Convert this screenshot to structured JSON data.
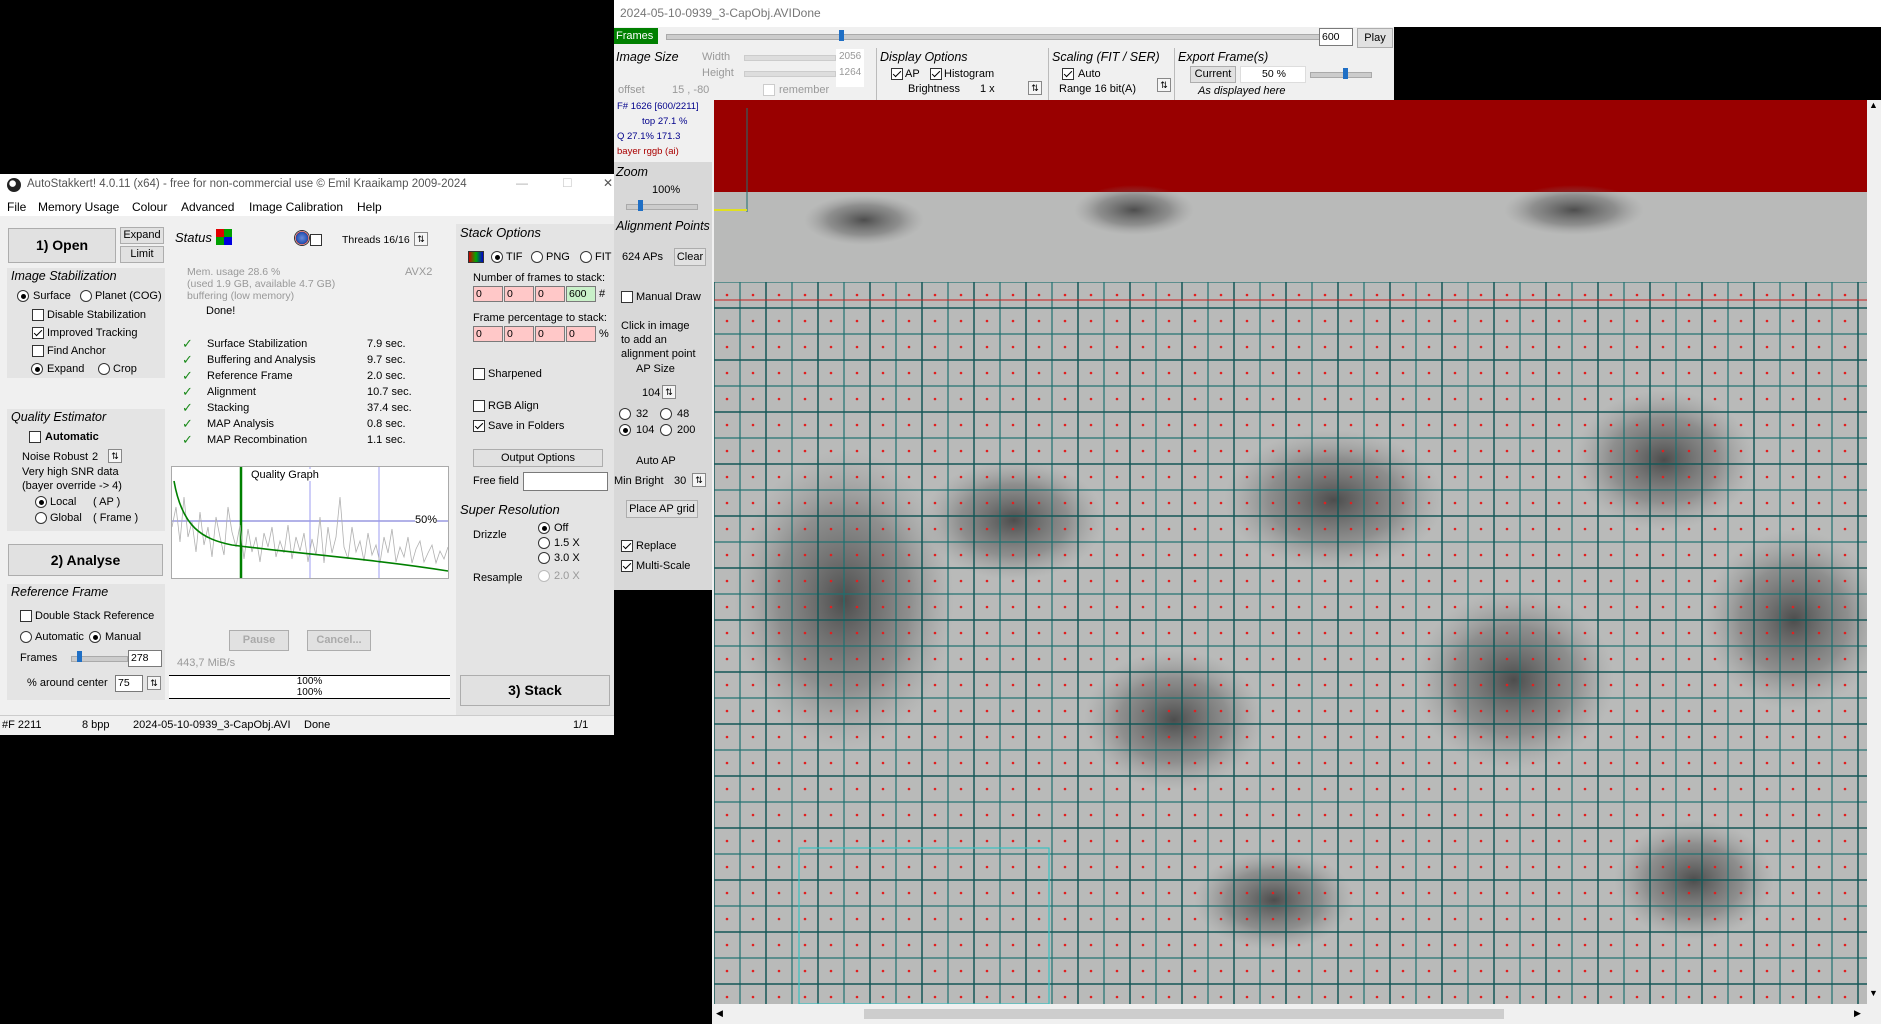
{
  "viewer": {
    "title": "2024-05-10-0939_3-CapObj.AVI",
    "title_status": "Done",
    "frames_label": "Frames",
    "frames_value": "600",
    "play_label": "Play",
    "image_size": {
      "title": "Image Size",
      "width_label": "Width",
      "height_label": "Height",
      "width": "2056",
      "height": "1264",
      "offset_label": "offset",
      "offset": "15 , -80",
      "remember_label": "remember"
    },
    "display_options": {
      "title": "Display Options",
      "ap_label": "AP",
      "histogram_label": "Histogram",
      "brightness_label": "Brightness",
      "brightness_value": "1 x"
    },
    "scaling": {
      "title": "Scaling (FIT / SER)",
      "auto_label": "Auto",
      "range_label": "Range 16 bit(A)"
    },
    "export": {
      "title": "Export Frame(s)",
      "current_label": "Current",
      "percent": "50 %",
      "as_displayed": "As displayed here"
    },
    "info": {
      "line1": "F# 1626 [600/2211]",
      "line2": "top 27.1 %",
      "line3": "Q 27.1%   171.3",
      "line4": "bayer rggb (ai)"
    },
    "zoom": {
      "title": "Zoom",
      "value": "100%"
    },
    "alignment": {
      "title": "Alignment Points",
      "aps": "624 APs",
      "clear_label": "Clear",
      "manual_draw_label": "Manual Draw",
      "hint": [
        "Click in image",
        "to add an",
        "alignment point"
      ],
      "ap_size_label": "AP Size",
      "ap_size_value": "104",
      "sizes": [
        "32",
        "48",
        "104",
        "200"
      ],
      "auto_ap_label": "Auto AP",
      "min_bright_label": "Min Bright",
      "min_bright_value": "30",
      "place_grid_label": "Place AP grid",
      "replace_label": "Replace",
      "multiscale_label": "Multi-Scale"
    }
  },
  "main": {
    "title": "AutoStakkert! 4.0.11 (x64) - free for non-commercial use © Emil Kraaikamp 2009-2024",
    "menu": [
      "File",
      "Memory Usage",
      "Colour",
      "Advanced",
      "Image Calibration",
      "Help"
    ],
    "open_label": "1) Open",
    "expand_label": "Expand",
    "limit_label": "Limit",
    "image_stabilization": {
      "title": "Image Stabilization",
      "surface_label": "Surface",
      "planet_label": "Planet (COG)",
      "disable_label": "Disable Stabilization",
      "improved_label": "Improved Tracking",
      "anchor_label": "Find Anchor",
      "expand_label": "Expand",
      "crop_label": "Crop"
    },
    "quality_estimator": {
      "title": "Quality Estimator",
      "automatic_label": "Automatic",
      "noise_label": "Noise Robust",
      "noise_value": "2",
      "snr_line1": "Very high SNR data",
      "snr_line2": "(bayer override -> 4)",
      "local_label": "Local",
      "local_suffix": "( AP )",
      "global_label": "Global",
      "global_suffix": "( Frame )"
    },
    "analyse_label": "2) Analyse",
    "reference_frame": {
      "title": "Reference Frame",
      "double_label": "Double Stack Reference",
      "automatic_label": "Automatic",
      "manual_label": "Manual",
      "frames_label": "Frames",
      "frames_value": "278",
      "around_label": "% around center",
      "around_value": "75"
    },
    "status": {
      "title": "Status",
      "threads_label": "Threads 16/16",
      "avx": "AVX2",
      "mem1": "Mem. usage 28.6 %",
      "mem2": "(used 1.9 GB, available 4.7 GB)",
      "mem3": "buffering (low memory)",
      "done": "Done!",
      "steps": [
        {
          "name": "Surface Stabilization",
          "time": "7.9 sec."
        },
        {
          "name": "Buffering and Analysis",
          "time": "9.7 sec."
        },
        {
          "name": "Reference Frame",
          "time": "2.0 sec."
        },
        {
          "name": "Alignment",
          "time": "10.7 sec."
        },
        {
          "name": "Stacking",
          "time": "37.4 sec."
        },
        {
          "name": "MAP Analysis",
          "time": "0.8 sec."
        },
        {
          "name": "MAP Recombination",
          "time": "1.1 sec."
        }
      ],
      "graph_title": "Quality Graph",
      "graph_pct": "50%",
      "pause_label": "Pause",
      "cancel_label": "Cancel...",
      "rate": "443,7 MiB/s",
      "prog1": "100%",
      "prog2": "100%"
    },
    "stack_options": {
      "title": "Stack Options",
      "tif_label": "TIF",
      "png_label": "PNG",
      "fit_label": "FIT",
      "frames_label": "Number of frames to stack:",
      "frames": [
        "0",
        "0",
        "0",
        "600"
      ],
      "frames_suffix": "#",
      "pct_label": "Frame percentage to stack:",
      "pcts": [
        "0",
        "0",
        "0",
        "0"
      ],
      "pct_suffix": "%",
      "sharpened_label": "Sharpened",
      "rgb_label": "RGB Align",
      "folders_label": "Save in Folders",
      "output_label": "Output Options",
      "free_label": "Free field"
    },
    "super_res": {
      "title": "Super Resolution",
      "drizzle_label": "Drizzle",
      "off": "Off",
      "x15": "1.5 X",
      "x30": "3.0 X",
      "resample_label": "Resample",
      "x20": "2.0 X"
    },
    "stack_label": "3) Stack",
    "statusbar": {
      "frame": "#F 2211",
      "bpp": "8 bpp",
      "file": "2024-05-10-0939_3-CapObj.AVI",
      "state": "Done",
      "page": "1/1"
    }
  },
  "colors": {
    "accent": "#1f6fc5",
    "banner": "#990000",
    "grid": "#1e6f6f",
    "ok": "#1a8a1a"
  }
}
